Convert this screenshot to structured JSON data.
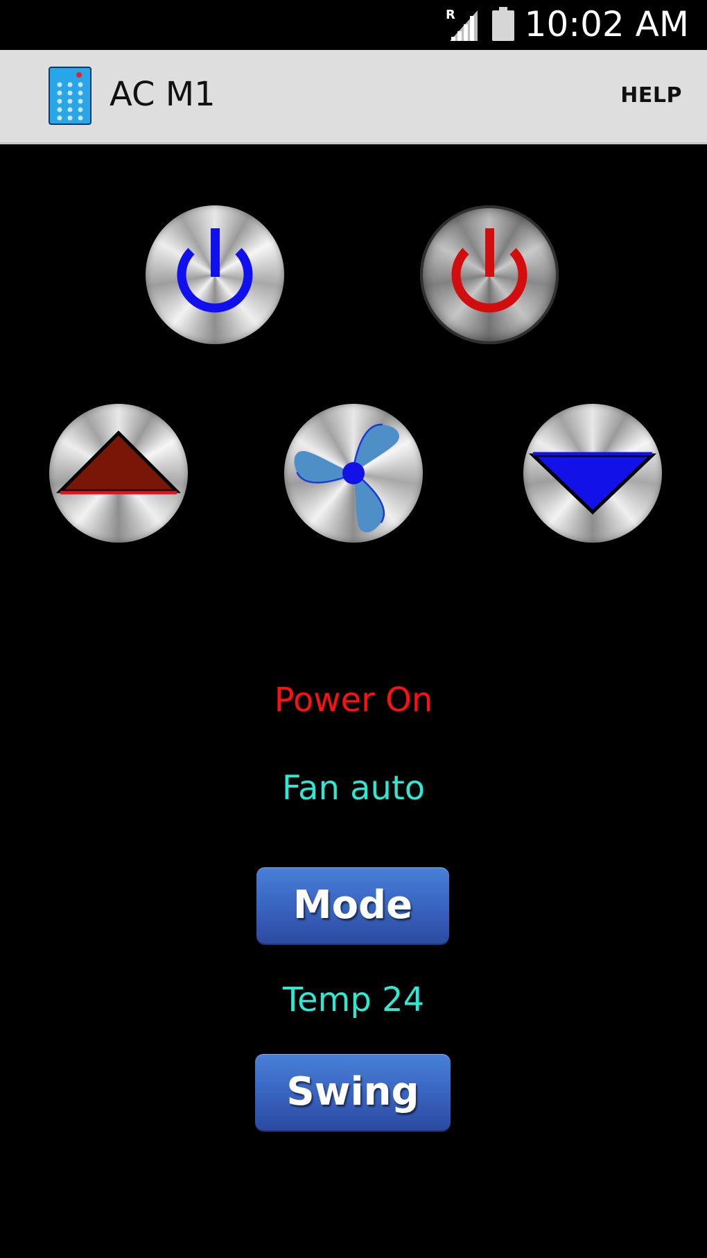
{
  "status_bar": {
    "time": "10:02 AM",
    "signal_label": "R"
  },
  "action_bar": {
    "title": "AC M1",
    "help_label": "HELP"
  },
  "controls": {
    "power_on_icon": "power-icon",
    "power_on_color": "#1010ee",
    "power_off_icon": "power-icon",
    "power_off_color": "#ff1010",
    "temp_up_icon": "triangle-up-icon",
    "temp_up_color": "#7a1608",
    "fan_icon": "fan-icon",
    "fan_color": "#4f8fc8",
    "temp_down_icon": "triangle-down-icon",
    "temp_down_color": "#1212e8"
  },
  "status": {
    "power": "Power On",
    "power_color": "#ff1010",
    "fan": "Fan auto",
    "fan_color": "#2ee8d4",
    "temp": "Temp 24",
    "temp_color": "#2ee8d4"
  },
  "buttons": {
    "mode_label": "Mode",
    "swing_label": "Swing"
  }
}
